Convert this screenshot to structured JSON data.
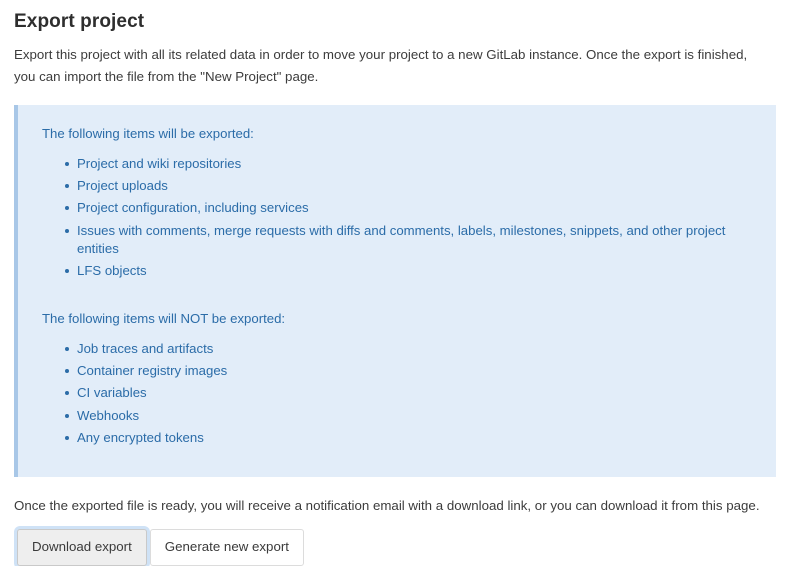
{
  "page": {
    "title": "Export project",
    "intro": "Export this project with all its related data in order to move your project to a new GitLab instance. Once the export is finished, you can import the file from the \"New Project\" page.",
    "footer_note": "Once the exported file is ready, you will receive a notification email with a download link, or you can download it from this page."
  },
  "info_panel": {
    "accent_color": "#a8c7e7",
    "background_color": "#e2edf9",
    "text_color": "#2b6ca8",
    "included_lead": "The following items will be exported:",
    "included_items": [
      "Project and wiki repositories",
      "Project uploads",
      "Project configuration, including services",
      "Issues with comments, merge requests with diffs and comments, labels, milestones, snippets, and other project entities",
      "LFS objects"
    ],
    "excluded_lead": "The following items will NOT be exported:",
    "excluded_items": [
      "Job traces and artifacts",
      "Container registry images",
      "CI variables",
      "Webhooks",
      "Any encrypted tokens"
    ]
  },
  "actions": {
    "download_label": "Download export",
    "generate_label": "Generate new export",
    "focus_ring_color": "#cfe2f6"
  }
}
